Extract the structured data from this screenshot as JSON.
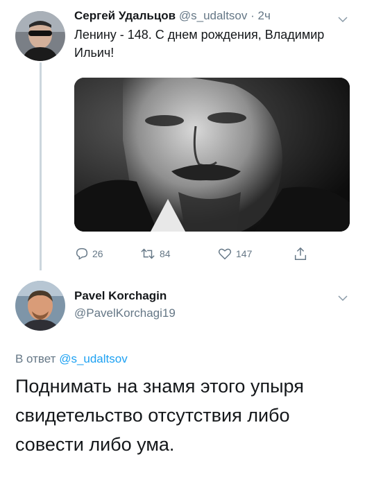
{
  "tweet": {
    "author_name": "Сергей Удальцов",
    "author_handle": "@s_udaltsov",
    "separator": "·",
    "time": "2ч",
    "text": "Ленину - 148. С днем рождения, Владимир Ильич!",
    "media_icon": "portrait-photo",
    "stats": {
      "replies": "26",
      "retweets": "84",
      "likes": "147"
    },
    "icons": {
      "reply": "reply-icon",
      "retweet": "retweet-icon",
      "like": "heart-icon",
      "share": "share-icon",
      "menu": "chevron-down-icon"
    }
  },
  "reply": {
    "author_name": "Pavel Korchagin",
    "author_handle": "@PavelKorchagi19",
    "reply_label": "В ответ",
    "reply_mention": "@s_udaltsov",
    "text": "Поднимать на знамя этого упыря свидетельство отсутствия либо совести либо ума."
  },
  "colors": {
    "text": "#14171a",
    "secondary": "#657786",
    "accent": "#1da1f2",
    "thread_line": "#ccd6dd"
  }
}
